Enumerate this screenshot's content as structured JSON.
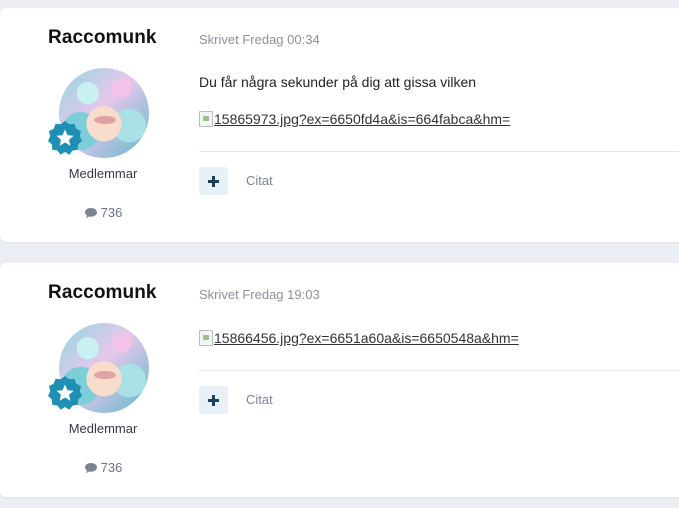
{
  "posts": [
    {
      "author": "Raccomunk",
      "rank": "Medlemmar",
      "post_count": "736",
      "timestamp": "Skrivet Fredag 00:34",
      "text": "Du får några sekunder på dig att gissa vilken",
      "image_alt": "15865973.jpg?ex=6650fd4a&is=664fabca&hm=",
      "quote_label": "Citat"
    },
    {
      "author": "Raccomunk",
      "rank": "Medlemmar",
      "post_count": "736",
      "timestamp": "Skrivet Fredag 19:03",
      "text": "",
      "image_alt": "15866456.jpg?ex=6651a60a&is=6650548a&hm=",
      "quote_label": "Citat"
    }
  ],
  "icons": {
    "badge": "star-badge-icon",
    "count": "speech-bubble-icon",
    "multiquote": "plus-icon"
  },
  "colors": {
    "page_bg": "#ebeef2",
    "card_bg": "#ffffff",
    "badge_teal": "#1f8fb3",
    "plus_dark": "#1d3d5c",
    "plus_bg": "#e8f0f8"
  }
}
